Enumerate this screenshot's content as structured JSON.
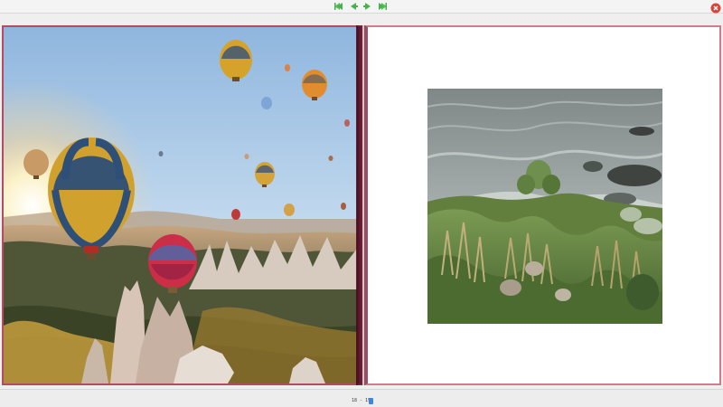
{
  "viewer": {
    "page_indicator": "18 - 19",
    "icons": {
      "first": "first-page-icon",
      "prev": "previous-page-icon",
      "next": "next-page-icon",
      "last": "last-page-icon",
      "close": "close-icon",
      "page_indicator_badge": "bookmark-icon"
    },
    "colors": {
      "accent_green": "#45b449",
      "close_red": "#d9453d",
      "border_pink": "#b34b63"
    }
  }
}
